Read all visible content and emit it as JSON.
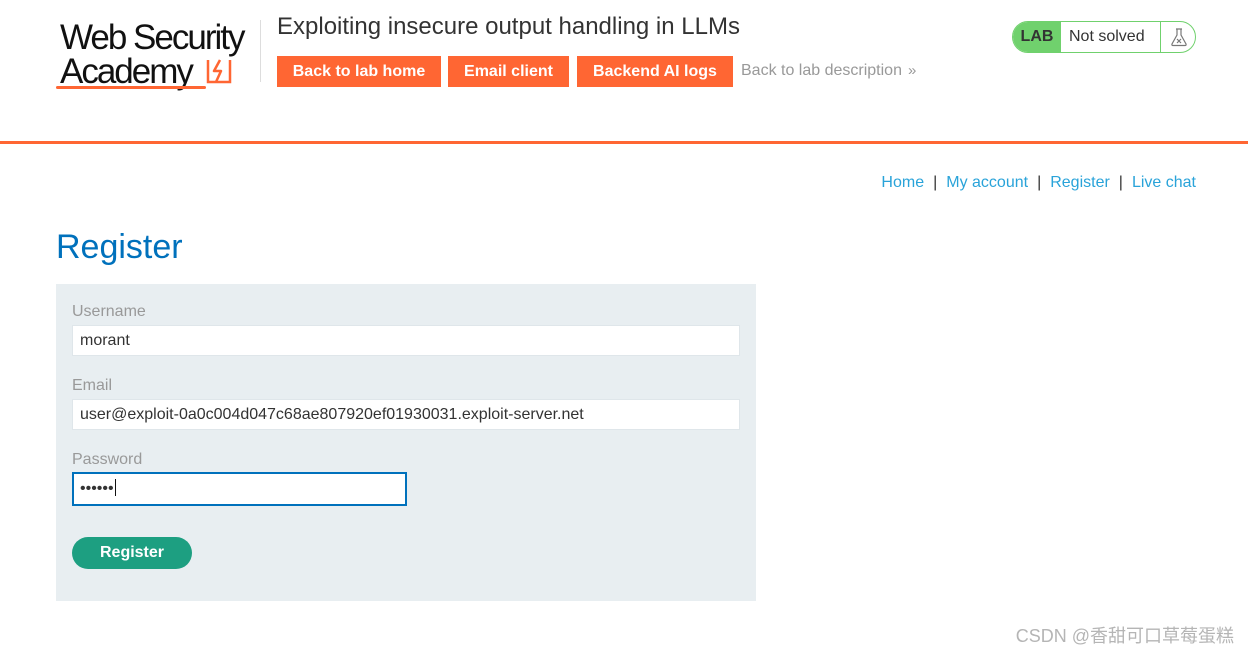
{
  "header": {
    "logo": {
      "line1": "Web Security",
      "line2": "Academy"
    },
    "lab_title": "Exploiting insecure output handling in LLMs",
    "buttons": {
      "back_to_lab_home": "Back to lab home",
      "email_client": "Email client",
      "backend_ai_logs": "Backend AI logs"
    },
    "back_to_description": "Back to lab description",
    "lab_status": {
      "badge": "LAB",
      "state": "Not solved"
    }
  },
  "top_links": [
    "Home",
    "My account",
    "Register",
    "Live chat"
  ],
  "main": {
    "title": "Register",
    "form": {
      "username_label": "Username",
      "username_value": "morant",
      "email_label": "Email",
      "email_value": "user@exploit-0a0c004d047c68ae807920ef01930031.exploit-server.net",
      "password_label": "Password",
      "password_masked": "••••••",
      "submit_label": "Register"
    }
  },
  "watermark": "CSDN @香甜可口草莓蛋糕",
  "colors": {
    "accent": "#ff6633",
    "title_blue": "#0071bc",
    "link_blue": "#29a3d9",
    "lab_green": "#70d16d",
    "submit_green": "#1d9f81",
    "panel_bg": "#e8eef1"
  },
  "icons": {
    "logo_mark": "lightning-bolt-icon",
    "lab_status": "flask-icon",
    "back_link": "double-chevron-right-icon"
  }
}
